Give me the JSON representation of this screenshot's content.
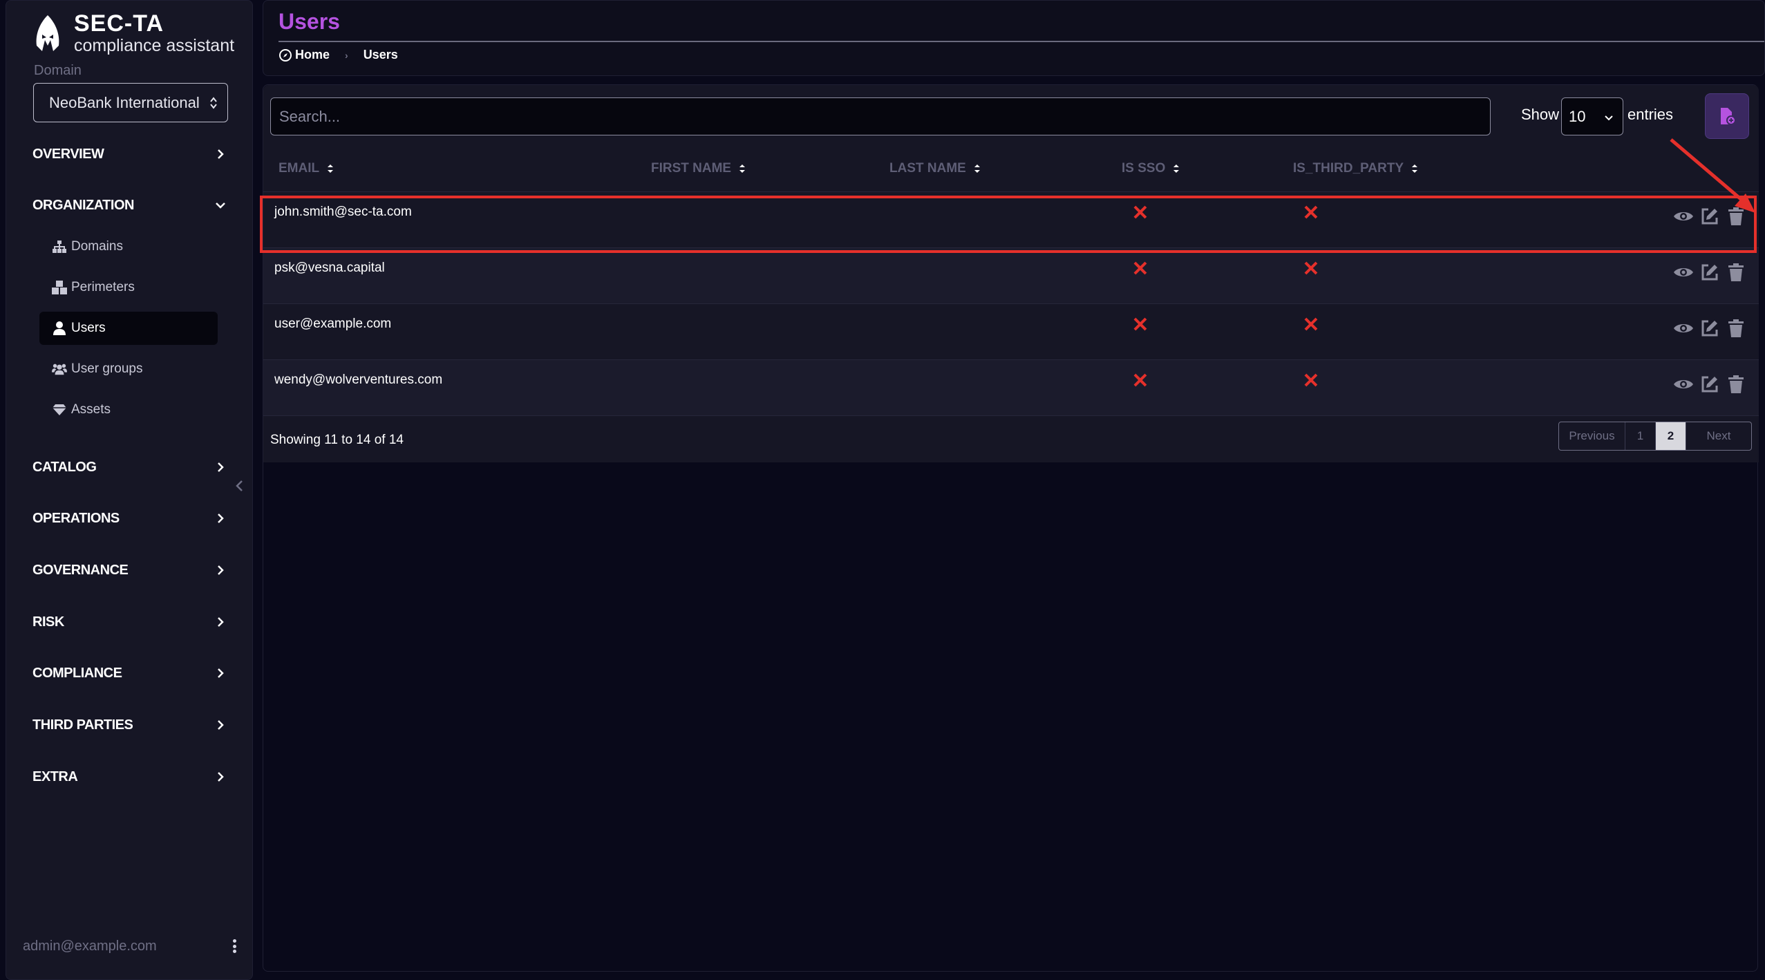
{
  "brand": {
    "name": "SEC-TA",
    "subtitle": "compliance assistant"
  },
  "domain": {
    "label": "Domain",
    "selected": "NeoBank International"
  },
  "nav": {
    "overview": "OVERVIEW",
    "organization": "ORGANIZATION",
    "organization_items": [
      {
        "label": "Domains",
        "icon": "sitemap-icon"
      },
      {
        "label": "Perimeters",
        "icon": "cubes-icon"
      },
      {
        "label": "Users",
        "icon": "user-icon",
        "active": true
      },
      {
        "label": "User groups",
        "icon": "users-icon"
      },
      {
        "label": "Assets",
        "icon": "gem-icon"
      }
    ],
    "catalog": "CATALOG",
    "operations": "OPERATIONS",
    "governance": "GOVERNANCE",
    "risk": "RISK",
    "compliance": "COMPLIANCE",
    "third_parties": "THIRD PARTIES",
    "extra": "EXTRA"
  },
  "footer": {
    "user": "admin@example.com"
  },
  "header": {
    "title": "Users",
    "breadcrumb": {
      "home": "Home",
      "current": "Users"
    }
  },
  "toolbar": {
    "search_placeholder": "Search...",
    "show_label": "Show",
    "entries_value": "10",
    "entries_label": "entries"
  },
  "table": {
    "columns": [
      "EMAIL",
      "FIRST NAME",
      "LAST NAME",
      "IS SSO",
      "IS_THIRD_PARTY"
    ],
    "rows": [
      {
        "email": "john.smith@sec-ta.com",
        "first_name": "",
        "last_name": "",
        "is_sso": false,
        "is_third_party": false
      },
      {
        "email": "psk@vesna.capital",
        "first_name": "",
        "last_name": "",
        "is_sso": false,
        "is_third_party": false
      },
      {
        "email": "user@example.com",
        "first_name": "",
        "last_name": "",
        "is_sso": false,
        "is_third_party": false
      },
      {
        "email": "wendy@wolverventures.com",
        "first_name": "",
        "last_name": "",
        "is_sso": false,
        "is_third_party": false
      }
    ],
    "showing": "Showing 11 to 14 of 14"
  },
  "pagination": {
    "previous": "Previous",
    "pages": [
      "1",
      "2"
    ],
    "current": "2",
    "next": "Next"
  },
  "colors": {
    "accent": "#b553e0",
    "danger": "#e5302b",
    "sidebar_bg": "#161625",
    "page_bg": "#09091a"
  }
}
